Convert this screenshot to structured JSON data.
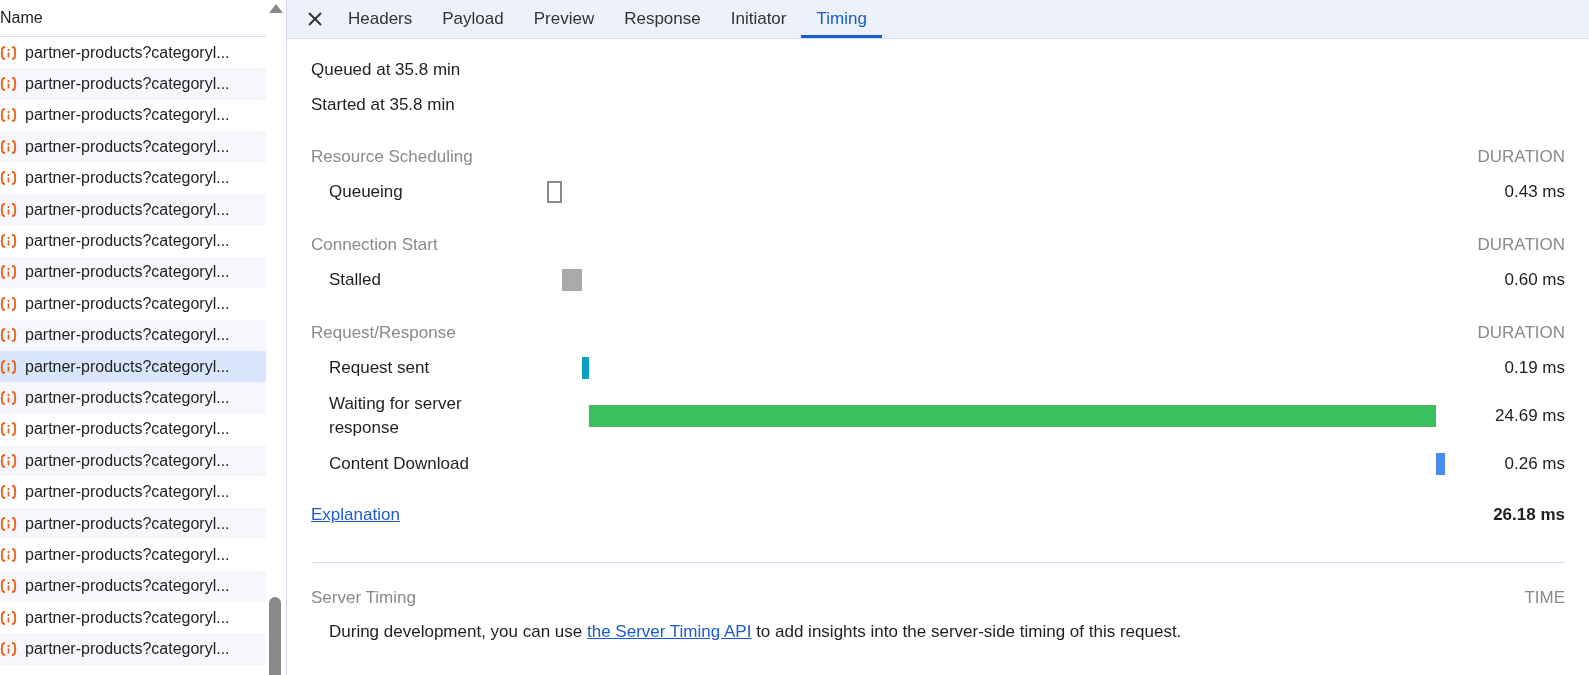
{
  "request_list": {
    "column_header": "Name",
    "rows": [
      {
        "name": "partner-products?categoryl...",
        "selected": false
      },
      {
        "name": "partner-products?categoryl...",
        "selected": false
      },
      {
        "name": "partner-products?categoryl...",
        "selected": false
      },
      {
        "name": "partner-products?categoryl...",
        "selected": false
      },
      {
        "name": "partner-products?categoryl...",
        "selected": false
      },
      {
        "name": "partner-products?categoryl...",
        "selected": false
      },
      {
        "name": "partner-products?categoryl...",
        "selected": false
      },
      {
        "name": "partner-products?categoryl...",
        "selected": false
      },
      {
        "name": "partner-products?categoryl...",
        "selected": false
      },
      {
        "name": "partner-products?categoryl...",
        "selected": false
      },
      {
        "name": "partner-products?categoryl...",
        "selected": true
      },
      {
        "name": "partner-products?categoryl...",
        "selected": false
      },
      {
        "name": "partner-products?categoryl...",
        "selected": false
      },
      {
        "name": "partner-products?categoryl...",
        "selected": false
      },
      {
        "name": "partner-products?categoryl...",
        "selected": false
      },
      {
        "name": "partner-products?categoryl...",
        "selected": false
      },
      {
        "name": "partner-products?categoryl...",
        "selected": false
      },
      {
        "name": "partner-products?categoryl...",
        "selected": false
      },
      {
        "name": "partner-products?categoryl...",
        "selected": false
      },
      {
        "name": "partner-products?categoryl...",
        "selected": false
      }
    ]
  },
  "tabs": [
    {
      "label": "Headers",
      "selected": false
    },
    {
      "label": "Payload",
      "selected": false
    },
    {
      "label": "Preview",
      "selected": false
    },
    {
      "label": "Response",
      "selected": false
    },
    {
      "label": "Initiator",
      "selected": false
    },
    {
      "label": "Timing",
      "selected": true
    }
  ],
  "timing": {
    "queued_at": "Queued at 35.8 min",
    "started_at": "Started at 35.8 min",
    "sections": [
      {
        "title": "Resource Scheduling",
        "column": "DURATION",
        "phases": [
          {
            "label": "Queueing",
            "duration": "0.43 ms",
            "kind": "outline",
            "color": "#8a8a8a"
          }
        ]
      },
      {
        "title": "Connection Start",
        "column": "DURATION",
        "phases": [
          {
            "label": "Stalled",
            "duration": "0.60 ms",
            "kind": "fill",
            "color": "#aaaaaa"
          }
        ]
      },
      {
        "title": "Request/Response",
        "column": "DURATION",
        "phases": [
          {
            "label": "Request sent",
            "duration": "0.19 ms",
            "kind": "fill",
            "color": "#06a0c4"
          },
          {
            "label": "Waiting for server response",
            "duration": "24.69 ms",
            "kind": "fill",
            "color": "#3abf60"
          },
          {
            "label": "Content Download",
            "duration": "0.26 ms",
            "kind": "fill",
            "color": "#4a8af2"
          }
        ]
      }
    ],
    "explanation_link": "Explanation",
    "total": "26.18 ms",
    "server_timing": {
      "title": "Server Timing",
      "column": "TIME",
      "text_before": "During development, you can use ",
      "link": "the Server Timing API",
      "text_after": " to add insights into the server-side timing of this request."
    }
  }
}
